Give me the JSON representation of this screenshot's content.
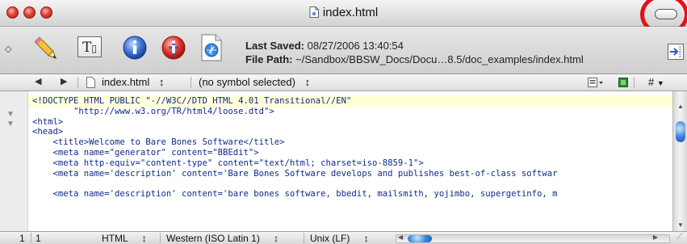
{
  "window": {
    "title": "index.html"
  },
  "toolbar": {
    "last_saved_label": "Last Saved:",
    "last_saved_value": "08/27/2006 13:40:54",
    "file_path_label": "File Path:",
    "file_path_value": "~/Sandbox/BBSW_Docs/Docu…8.5/doc_examples/index.html",
    "text_options_label": "T"
  },
  "navbar": {
    "back_arrow": "◀",
    "forward_arrow": "▶",
    "file_name": "index.html",
    "symbol": "(no symbol selected)",
    "updown": "↕",
    "hash": "#"
  },
  "editor": {
    "lines": [
      "<!DOCTYPE HTML PUBLIC \"-//W3C//DTD HTML 4.01 Transitional//EN\"",
      "        \"http://www.w3.org/TR/html4/loose.dtd\">",
      "<html>",
      "<head>",
      "    <title>Welcome to Bare Bones Software</title>",
      "    <meta name=\"generator\" content=\"BBEdit\">",
      "    <meta http-equiv=\"content-type\" content=\"text/html; charset=iso-8859-1\">",
      "    <meta name='description' content='Bare Bones Software develops and publishes best-of-class softwar",
      "",
      "    <meta name='description' content='bare bones software, bbedit, mailsmith, yojimbo, supergetinfo, m"
    ]
  },
  "status": {
    "line": "1",
    "column": "1",
    "language": "HTML",
    "encoding": "Western (ISO Latin 1)",
    "line_endings": "Unix (LF)"
  },
  "colors": {
    "annotation_ring": "#e3101a",
    "code_text": "#102a8a",
    "current_line": "#ffffd8"
  }
}
